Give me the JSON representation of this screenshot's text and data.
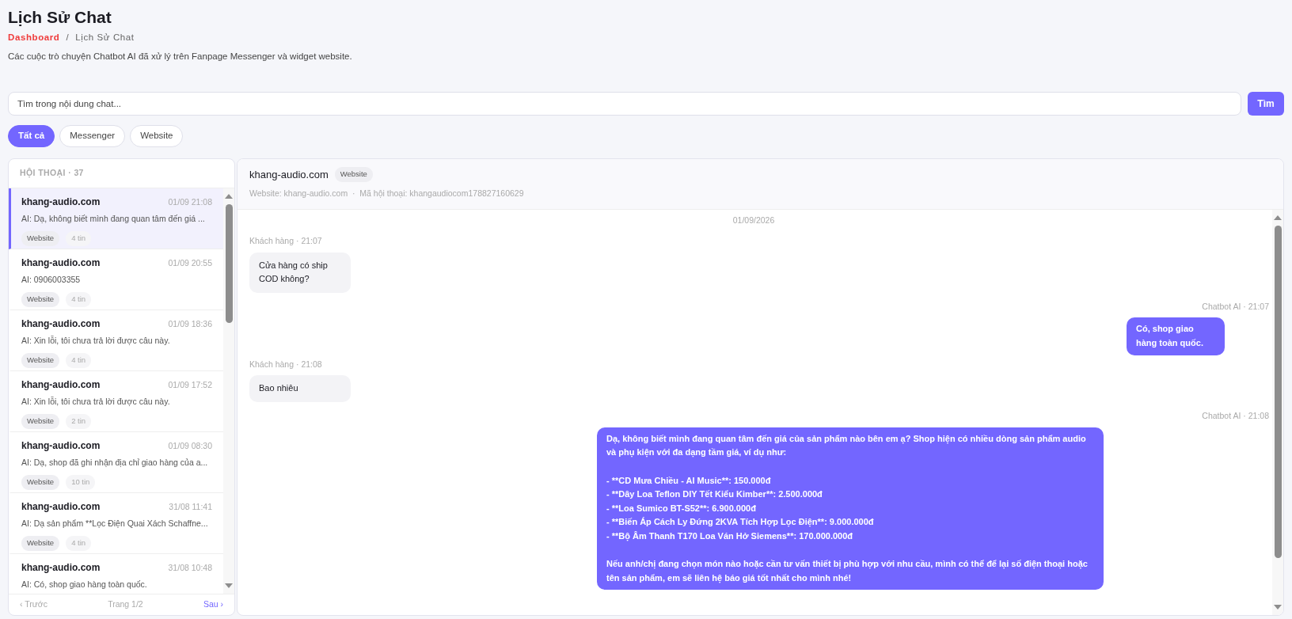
{
  "page": {
    "title": "Lịch Sử Chat",
    "breadcrumb": [
      {
        "label": "Dashboard",
        "kind": "link"
      },
      {
        "label": "/",
        "kind": "separator"
      },
      {
        "label": "Lịch Sử Chat",
        "kind": "current"
      }
    ],
    "description": "Các cuộc trò chuyện Chatbot AI đã xử lý trên Fanpage Messenger và widget website."
  },
  "search": {
    "placeholder": "Tìm trong nội dung chat...",
    "button": "Tìm"
  },
  "filters": [
    {
      "label": "Tất cả",
      "selected": true
    },
    {
      "label": "Messenger",
      "selected": false
    },
    {
      "label": "Website",
      "selected": false
    }
  ],
  "conversations": {
    "header": "HỘI THOẠI · 37",
    "items": [
      {
        "name": "khang-audio.com",
        "time": "01/09 21:08",
        "preview": "AI: Dạ, không biết mình đang quan tâm đến giá ...",
        "channel": "Website",
        "count": "4 tin",
        "selected": true
      },
      {
        "name": "khang-audio.com",
        "time": "01/09 20:55",
        "preview": "AI: 0906003355",
        "channel": "Website",
        "count": "4 tin",
        "selected": false
      },
      {
        "name": "khang-audio.com",
        "time": "01/09 18:36",
        "preview": "AI: Xin lỗi, tôi chưa trả lời được câu này.",
        "channel": "Website",
        "count": "4 tin",
        "selected": false
      },
      {
        "name": "khang-audio.com",
        "time": "01/09 17:52",
        "preview": "AI: Xin lỗi, tôi chưa trả lời được câu này.",
        "channel": "Website",
        "count": "2 tin",
        "selected": false
      },
      {
        "name": "khang-audio.com",
        "time": "01/09 08:30",
        "preview": "AI: Dạ, shop đã ghi nhận địa chỉ giao hàng của a...",
        "channel": "Website",
        "count": "10 tin",
        "selected": false
      },
      {
        "name": "khang-audio.com",
        "time": "31/08 11:41",
        "preview": "AI: Dạ sản phẩm **Lọc Điện Quai Xách Schaffne...",
        "channel": "Website",
        "count": "4 tin",
        "selected": false
      },
      {
        "name": "khang-audio.com",
        "time": "31/08 10:48",
        "preview": "AI: Có, shop giao hàng toàn quốc."
      }
    ],
    "pagination": {
      "prev": "‹ Trước",
      "page": "Trang 1/2",
      "next": "Sau ›"
    }
  },
  "chat": {
    "title": "khang-audio.com",
    "channel": "Website",
    "meta": "Website: khang-audio.com  ·  Mã hội thoại: khangaudiocom178827160629",
    "date": "01/09/2026",
    "messages": [
      {
        "kind": "customer",
        "meta": "Khách hàng · 21:07",
        "text": "Cửa hàng có ship COD không?"
      },
      {
        "kind": "ai",
        "meta": "Chatbot AI · 21:07",
        "text": "Có, shop giao hàng toàn quốc."
      },
      {
        "kind": "customer",
        "meta": "Khách hàng · 21:08",
        "text": "Bao nhiêu"
      },
      {
        "kind": "ai",
        "meta": "Chatbot AI · 21:08",
        "text": "Dạ, không biết mình đang quan tâm đến giá của sản phẩm nào bên em ạ? Shop hiện có nhiều dòng sản phẩm audio và phụ kiện với đa dạng tầm giá, ví dụ như:\n\n- **CD Mưa Chiều - AI Music**: 150.000đ\n- **Dây Loa Teflon DIY Tết Kiểu Kimber**: 2.500.000đ\n- **Loa Sumico BT-S52**: 6.900.000đ\n- **Biến Áp Cách Ly Đứng 2KVA Tích Hợp Lọc Điện**: 9.000.000đ\n- **Bộ Âm Thanh T170 Loa Ván Hở Siemens**: 170.000.000đ\n\nNếu anh/chị đang chọn món nào hoặc cần tư vấn thiết bị phù hợp với nhu cầu, mình có thể để lại số điện thoại hoặc tên sản phẩm, em sẽ liên hệ báo giá tốt nhất cho mình nhé!"
      }
    ]
  }
}
